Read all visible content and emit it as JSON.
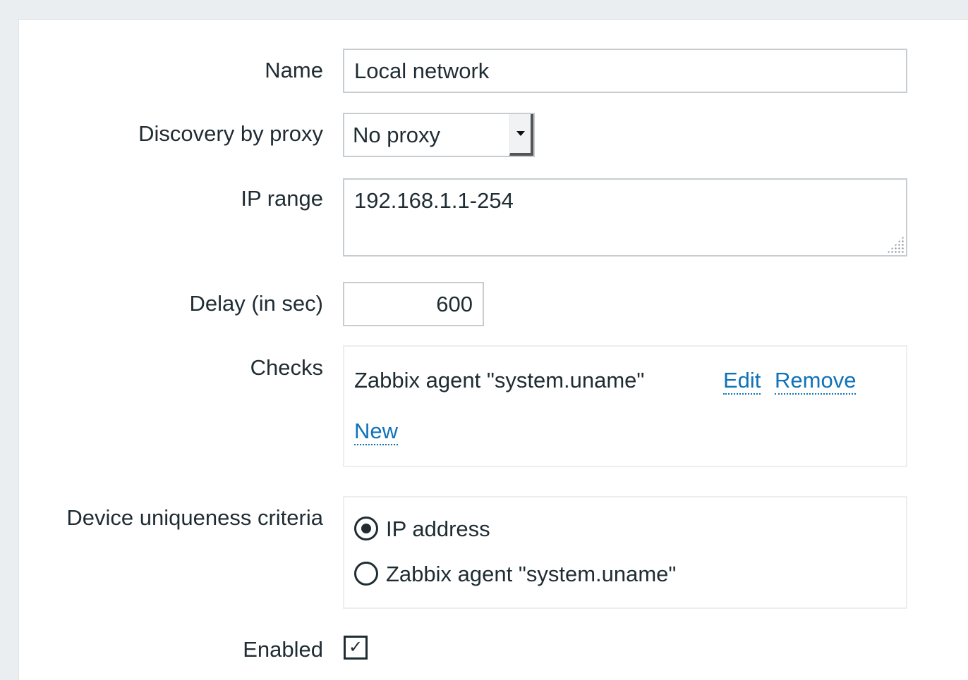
{
  "form": {
    "name": {
      "label": "Name",
      "value": "Local network"
    },
    "proxy": {
      "label": "Discovery by proxy",
      "selected": "No proxy"
    },
    "ip_range": {
      "label": "IP range",
      "value": "192.168.1.1-254"
    },
    "delay": {
      "label": "Delay (in sec)",
      "value": "600"
    },
    "checks": {
      "label": "Checks",
      "items": [
        {
          "text": "Zabbix agent \"system.uname\"",
          "edit": "Edit",
          "remove": "Remove"
        }
      ],
      "new_link": "New"
    },
    "uniqueness": {
      "label": "Device uniqueness criteria",
      "options": [
        {
          "text": "IP address",
          "selected": true
        },
        {
          "text": "Zabbix agent \"system.uname\"",
          "selected": false
        }
      ]
    },
    "enabled": {
      "label": "Enabled",
      "checked": true,
      "check_glyph": "✓"
    }
  },
  "colors": {
    "background": "#ebeef0",
    "panel": "#ffffff",
    "link": "#0f72b8",
    "text": "#1f2c33",
    "border": "#c6ccd0"
  }
}
